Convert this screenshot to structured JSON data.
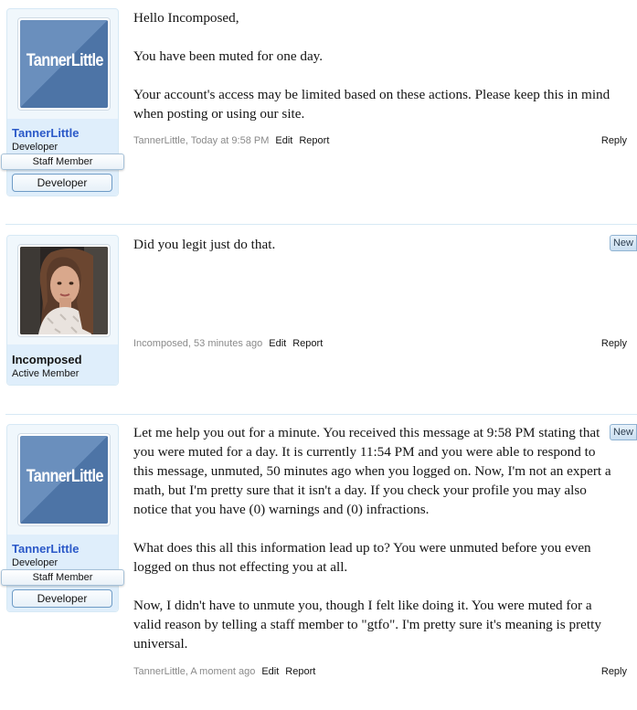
{
  "posts": [
    {
      "user": {
        "name": "TannerLittle",
        "title": "Developer",
        "staff_banner": "Staff Member",
        "banner": "Developer",
        "avatar_text": "TannerLittle"
      },
      "message": [
        "Hello Incomposed,",
        "You have been muted for one day.",
        "Your account's access may be limited based on these actions. Please keep this in mind when posting or using our site."
      ],
      "meta": {
        "author_time": "TannerLittle, Today at 9:58 PM",
        "edit": "Edit",
        "report": "Report",
        "reply": "Reply"
      }
    },
    {
      "user": {
        "name": "Incomposed",
        "title": "Active Member"
      },
      "badge": "New",
      "message": [
        "Did you legit just do that."
      ],
      "meta": {
        "author_time": "Incomposed, 53 minutes ago",
        "edit": "Edit",
        "report": "Report",
        "reply": "Reply"
      }
    },
    {
      "user": {
        "name": "TannerLittle",
        "title": "Developer",
        "staff_banner": "Staff Member",
        "banner": "Developer",
        "avatar_text": "TannerLittle"
      },
      "badge": "New",
      "message": [
        "Let me help you out for a minute. You received this message at 9:58 PM stating that you were muted for a day. It is currently 11:54 PM and you were able to respond to this message, unmuted, 50 minutes ago when you logged on. Now, I'm not an expert a math, but I'm pretty sure that it isn't a day. If you check your profile you may also notice that you have (0) warnings and (0) infractions.",
        "What does this all this information lead up to? You were unmuted before you even logged on thus not effecting you at all.",
        "Now, I didn't have to unmute you, though I felt like doing it. You were muted for a valid reason by telling a staff member to \"gtfo\". I'm pretty sure it's meaning is pretty universal."
      ],
      "meta": {
        "author_time": "TannerLittle, A moment ago",
        "edit": "Edit",
        "report": "Report",
        "reply": "Reply"
      }
    }
  ]
}
